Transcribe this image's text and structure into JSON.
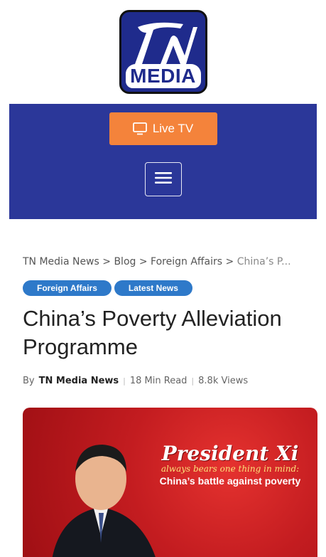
{
  "brand": {
    "logo_text": "MEDIA",
    "logo_mark": "TN",
    "brand_color": "#2b3799"
  },
  "header": {
    "live_tv_label": "Live TV",
    "live_tv_icon": "tv-icon",
    "menu_icon": "hamburger-icon",
    "accent": "#f4833b"
  },
  "breadcrumb": {
    "items": [
      "TN Media News",
      "Blog",
      "Foreign Affairs"
    ],
    "current": "China’s P...",
    "separator": ">"
  },
  "tags": [
    "Foreign Affairs",
    "Latest News"
  ],
  "article": {
    "title": "China’s Poverty Alleviation Programme",
    "by_label": "By",
    "author": "TN Media News",
    "read_time": "18 Min Read",
    "views": "8.8k Views"
  },
  "hero": {
    "headline": "President Xi",
    "subline": "always bears one thing in mind:",
    "subline2": "China’s battle against poverty"
  }
}
